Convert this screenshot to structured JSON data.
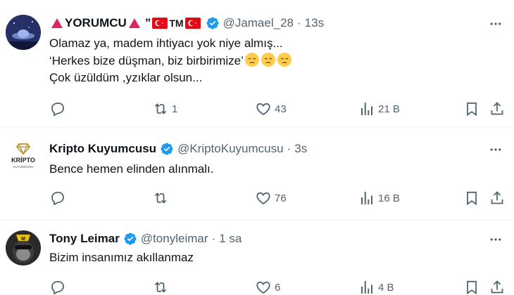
{
  "tweets": [
    {
      "name": "YORUMCU",
      "name_suffix_quote": "”",
      "name_tm": "TM",
      "handle": "@Jamael_28",
      "time": "13s",
      "lines": [
        "Olamaz ya, madem ihtiyacı yok niye almış...",
        "‘Herkes bize düşman, biz birbirimize’",
        "Çok üzüldüm ,yzıklar olsun..."
      ],
      "replies": "",
      "retweets": "1",
      "likes": "43",
      "views": "21 B",
      "avatar_icon": "ufo-night-avatar"
    },
    {
      "name": "Kripto Kuyumcusu",
      "handle": "@KriptoKuyumcusu",
      "time": "3s",
      "avatar_text": "KRİPTO",
      "avatar_subtext": "KUYUMCUSU",
      "lines": [
        "Bence hemen elinden alınmalı."
      ],
      "replies": "",
      "retweets": "",
      "likes": "76",
      "views": "16 B"
    },
    {
      "name": "Tony Leimar",
      "handle": "@tonyleimar",
      "time": "1 sa",
      "lines": [
        "Bizim insanımız akıllanmaz"
      ],
      "replies": "",
      "retweets": "",
      "likes": "6",
      "views": "4 B",
      "avatar_icon": "ape-avatar"
    }
  ],
  "colors": {
    "verified": "#1d9bf0",
    "text": "#0f1419",
    "muted": "#536471",
    "divider": "#eff3f4"
  }
}
